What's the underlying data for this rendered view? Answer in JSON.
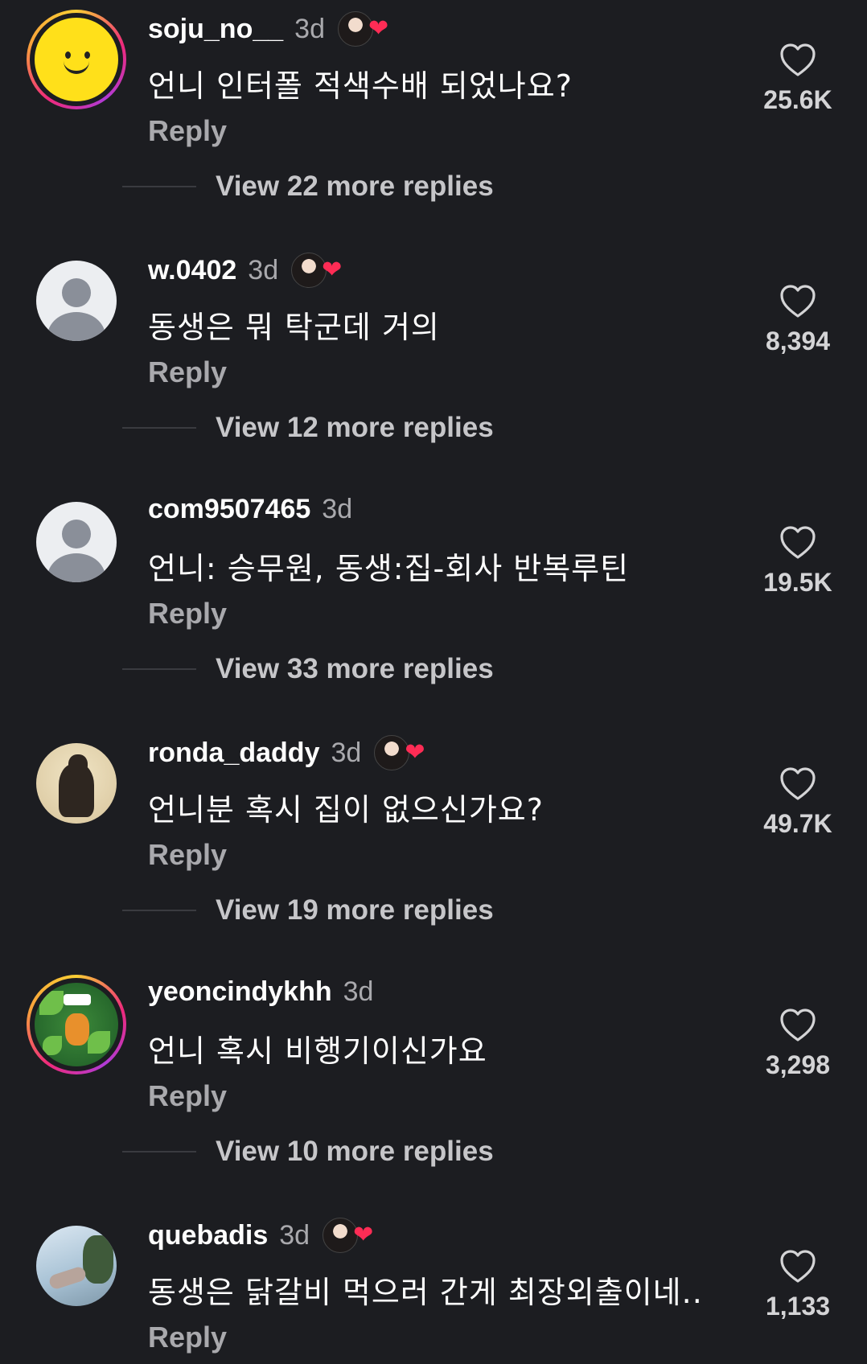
{
  "comments": [
    {
      "username": "soju_no__",
      "time": "3d",
      "creator_liked": true,
      "text": "언니 인터폴 적색수배 되었나요?",
      "reply_label": "Reply",
      "likes": "25.6K",
      "view_more": "View 22 more replies",
      "avatar": "smiley-yellow-story-ring"
    },
    {
      "username": "w.0402",
      "time": "3d",
      "creator_liked": true,
      "text": "동생은 뭐 탁군데 거의",
      "reply_label": "Reply",
      "likes": "8,394",
      "view_more": "View 12 more replies",
      "avatar": "default-avatar"
    },
    {
      "username": "com9507465",
      "time": "3d",
      "creator_liked": false,
      "text": "언니: 승무원, 동생:집-회사 반복루틴",
      "reply_label": "Reply",
      "likes": "19.5K",
      "view_more": "View 33 more replies",
      "avatar": "default-avatar"
    },
    {
      "username": "ronda_daddy",
      "time": "3d",
      "creator_liked": true,
      "text": "언니분 혹시 집이 없으신가요?",
      "reply_label": "Reply",
      "likes": "49.7K",
      "view_more": "View 19 more replies",
      "avatar": "dog-illustration"
    },
    {
      "username": "yeoncindykhh",
      "time": "3d",
      "creator_liked": false,
      "text": "언니 혹시 비행기이신가요",
      "reply_label": "Reply",
      "likes": "3,298",
      "view_more": "View 10 more replies",
      "avatar": "jungle-illustration-story-ring"
    },
    {
      "username": "quebadis",
      "time": "3d",
      "creator_liked": true,
      "text": "동생은 닭갈비 먹으러 간게 최장외출이네..",
      "reply_label": "Reply",
      "likes": "1,133",
      "view_more": "",
      "avatar": "sky-photo"
    }
  ],
  "colors": {
    "background": "#1c1d21",
    "secondary_text": "#a9a9ad",
    "like_heart": "#fe2c55"
  }
}
